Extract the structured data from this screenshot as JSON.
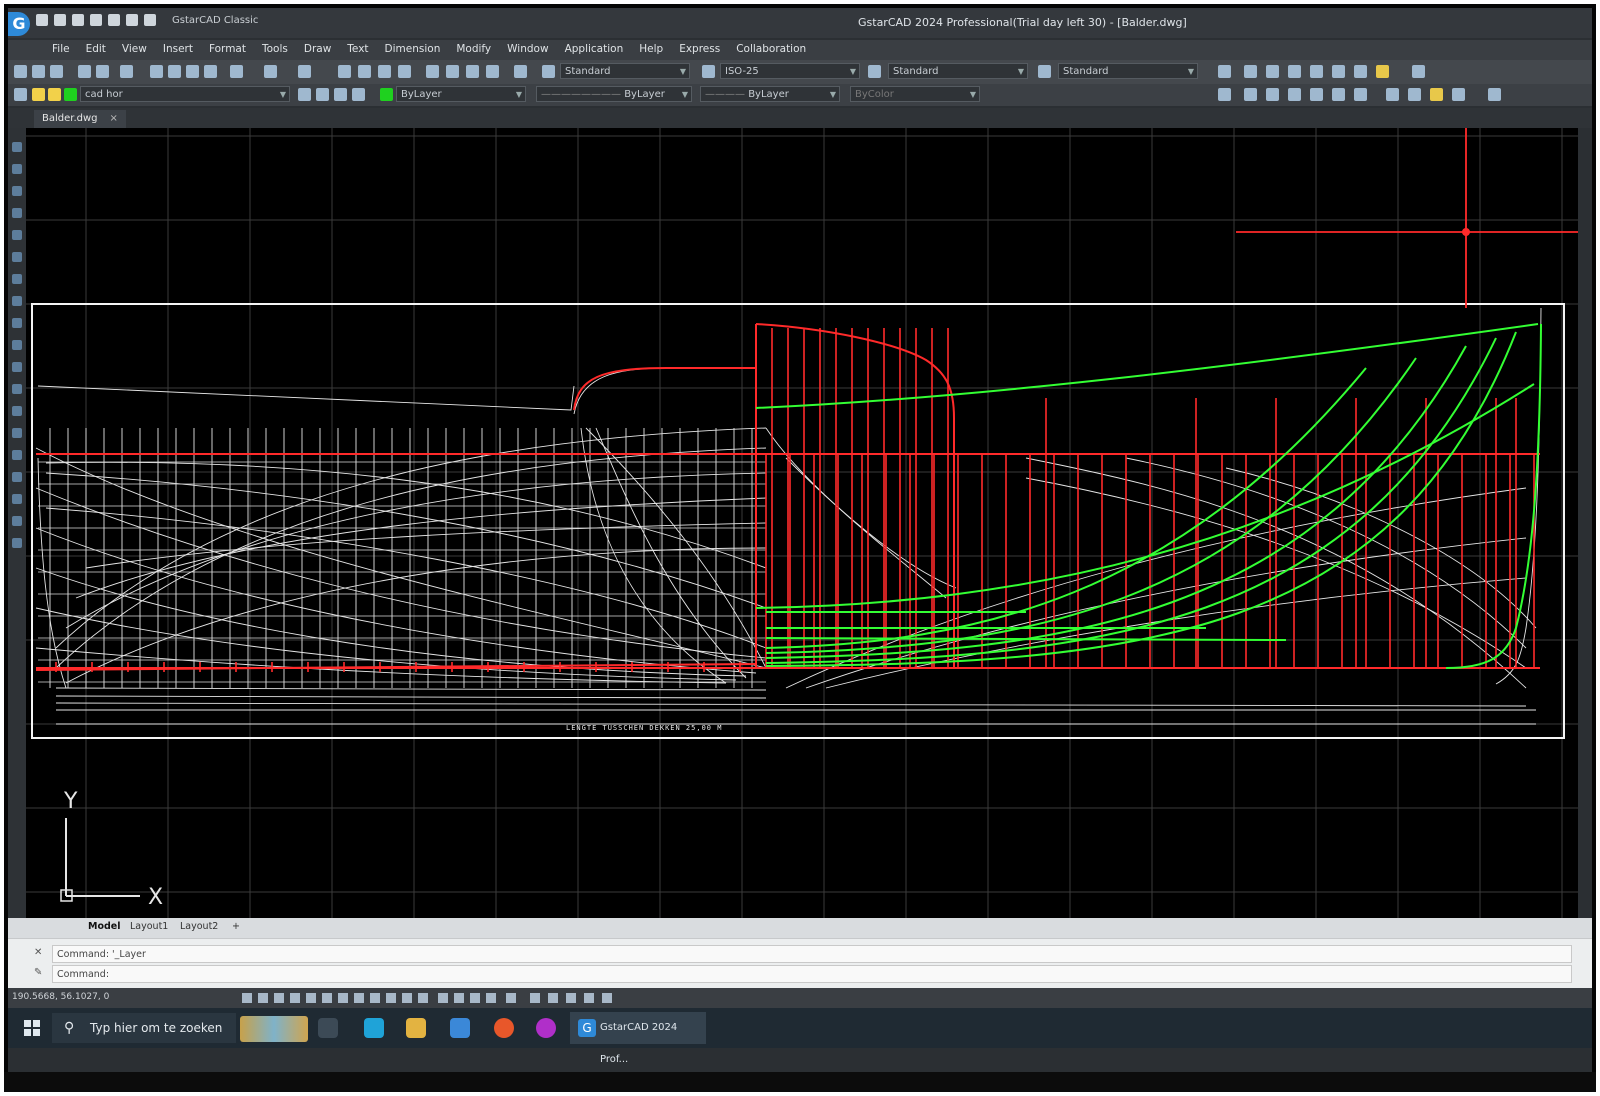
{
  "window": {
    "title": "GstarCAD 2024 Professional(Trial day left 30) - [Balder.dwg]",
    "qat_label": "GstarCAD Classic",
    "logo_letter": "G"
  },
  "menu": [
    "File",
    "Edit",
    "View",
    "Insert",
    "Format",
    "Tools",
    "Draw",
    "Text",
    "Dimension",
    "Modify",
    "Window",
    "Application",
    "Help",
    "Express",
    "Collaboration"
  ],
  "toolbar1": {
    "text_style": "Standard",
    "dim_style": "ISO-25",
    "table_style": "Standard",
    "multileader_style": "Standard"
  },
  "toolbar2": {
    "layer": "cad hor",
    "color": "ByLayer",
    "linetype": "ByLayer",
    "lineweight": "ByLayer",
    "plotstyle": "ByColor"
  },
  "document_tab": {
    "label": "Balder.dwg",
    "close": "×"
  },
  "drawing": {
    "ucs_y": "Y",
    "ucs_x": "X",
    "overall_length_label": "LENGTE TUSSCHEN DEKKEN  25,00 M"
  },
  "layout_tabs": [
    "Model",
    "Layout1",
    "Layout2",
    "+"
  ],
  "command": {
    "line1": "Command:  '_Layer",
    "line2": "Command:"
  },
  "status": {
    "coords": "190.5668, 56.1027, 0"
  },
  "taskbar": {
    "search_placeholder": "Typ hier om te zoeken",
    "active_app": "GstarCAD 2024 Prof..."
  },
  "colors": {
    "canvas_bg": "#000000",
    "red_layer": "#ff2a2a",
    "green_layer": "#33ff33",
    "white_layer": "#e8e8e8",
    "grid": "#3a3a3a"
  }
}
